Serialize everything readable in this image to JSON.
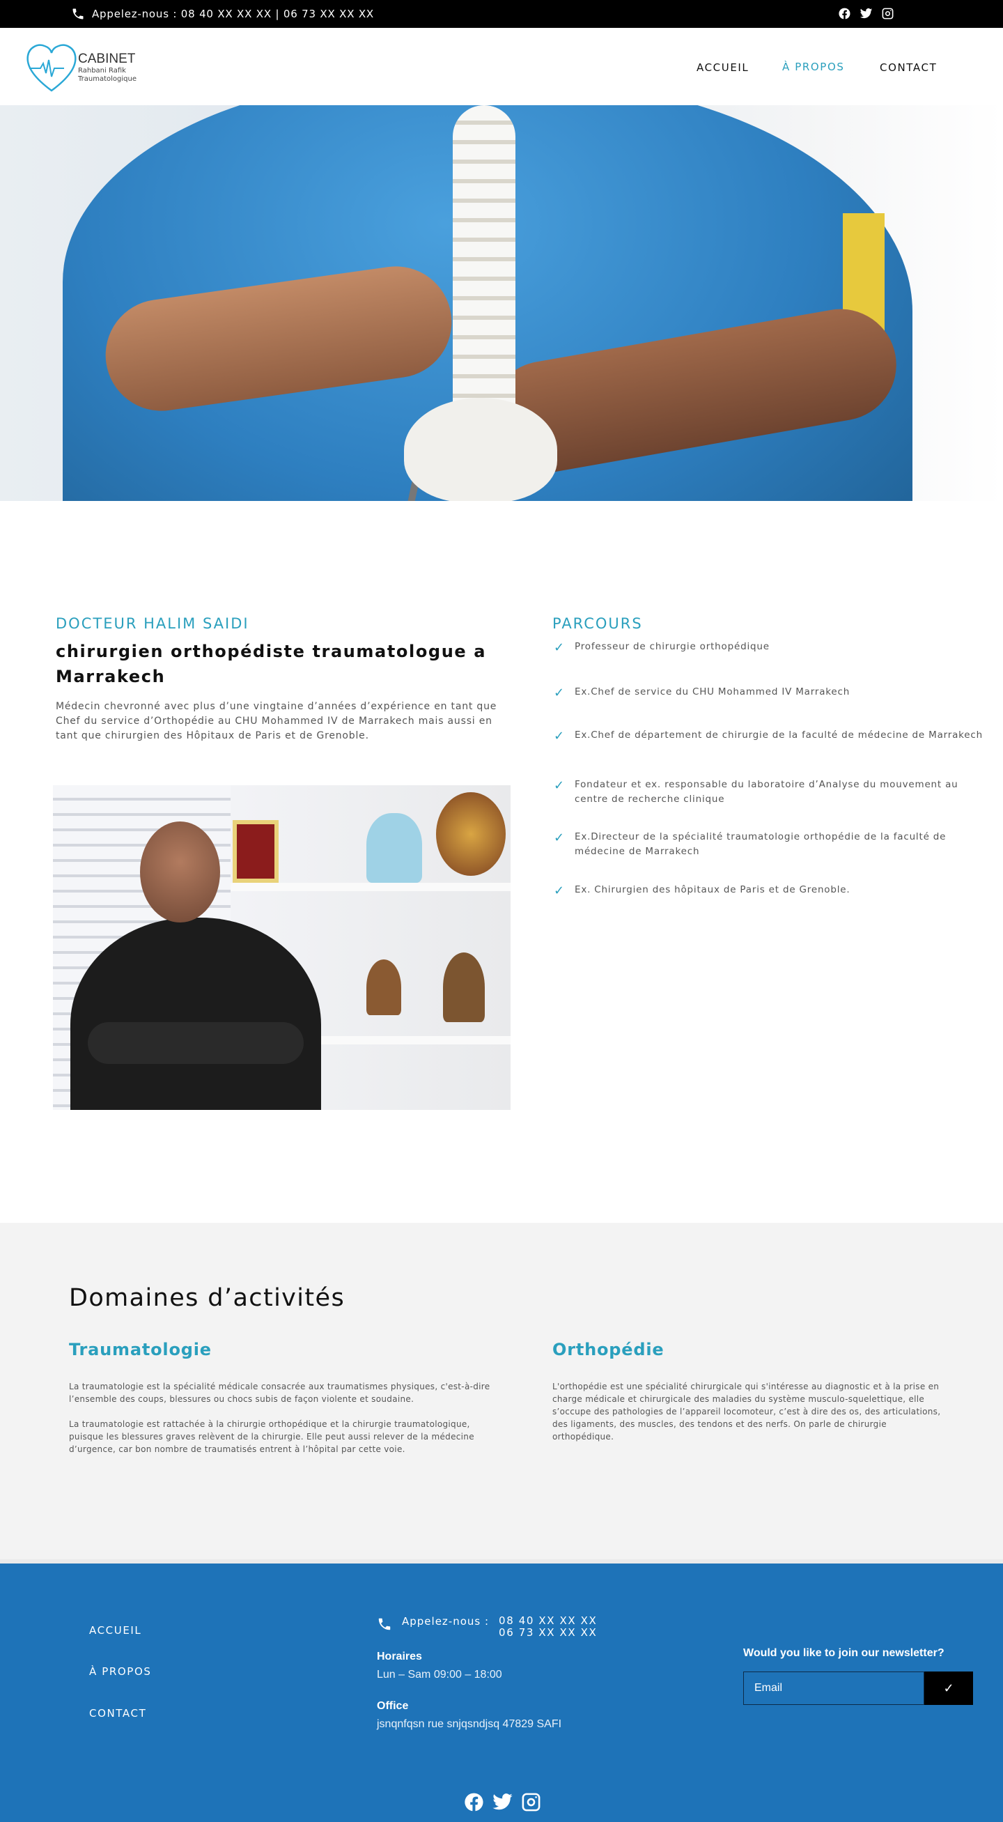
{
  "topbar": {
    "phone_text": "Appelez-nous : 08 40 XX XX XX | 06 73 XX XX XX",
    "socials": [
      "facebook-icon",
      "twitter-icon",
      "instagram-icon"
    ]
  },
  "header": {
    "logo_brand": "CABINET",
    "logo_sub1": "Rahbani Rafik",
    "logo_sub2": "Traumatologique",
    "nav": [
      {
        "label": "ACCUEIL",
        "active": false
      },
      {
        "label": "À PROPOS",
        "active": true
      },
      {
        "label": "CONTACT",
        "active": false
      }
    ]
  },
  "about": {
    "doctor_name": "DOCTEUR HALIM SAIDI",
    "specialty": "chirurgien orthopédiste traumatologue a Marrakech",
    "description": "Médecin chevronné avec plus d’une vingtaine d’années d’expérience en tant que Chef du service d’Orthopédie au CHU Mohammed IV de Marrakech mais aussi en tant que chirurgien des Hôpitaux de Paris et de Grenoble.",
    "parcours_title": "PARCOURS",
    "parcours": [
      "Professeur de chirurgie orthopédique",
      "Ex.Chef de service du CHU Mohammed IV Marrakech",
      "Ex.Chef de département de chirurgie de la faculté de médecine de Marrakech",
      "Fondateur et ex. responsable du laboratoire d’Analyse du mouvement au centre de recherche clinique",
      "Ex.Directeur de la spécialité traumatologie orthopédie de la faculté de médecine de Marrakech",
      "Ex. Chirurgien des hôpitaux de Paris et de Grenoble."
    ]
  },
  "domains": {
    "title": "Domaines d’activités",
    "traumatologie": {
      "title": "Traumatologie",
      "p1": "La traumatologie est la spécialité médicale consacrée aux traumatismes physiques, c'est-à-dire l’ensemble des  coups, blessures ou chocs subis de façon violente et soudaine.",
      "p2": "La traumatologie est rattachée à la chirurgie orthopédique et la chirurgie traumatologique, puisque les blessures graves relèvent de la chirurgie. Elle peut aussi relever de la médecine d’urgence, car bon nombre de traumatisés entrent à l’hôpital par cette voie."
    },
    "orthopedie": {
      "title": "Orthopédie",
      "p1": "L'orthopédie est une spécialité chirurgicale qui s'intéresse au diagnostic et à la prise en charge médicale et chirurgicale des maladies du système musculo-squelettique,  elle s’occupe des pathologies de l’appareil locomoteur, c’est à dire des os, des articulations, des ligaments, des muscles, des tendons et des nerfs. On parle de chirurgie orthopédique."
    }
  },
  "footer": {
    "links": [
      "ACCUEIL",
      "À PROPOS",
      "CONTACT"
    ],
    "call_label": "Appelez-nous :",
    "phone1": "08 40 XX XX XX",
    "phone2": "06 73 XX XX XX",
    "hours_label": "Horaires",
    "hours_value": "Lun – Sam 09:00 – 18:00",
    "office_label": "Office",
    "office_value": "jsnqnfqsn rue snjqsndjsq 47829 SAFI",
    "newsletter_question": "Would you like to join our newsletter?",
    "email_placeholder": "Email",
    "submit_icon": "checkmark-icon",
    "socials": [
      "facebook-icon",
      "twitter-icon",
      "instagram-icon"
    ]
  },
  "colors": {
    "accent": "#2a9fbd",
    "footer_bg": "#1e73b8",
    "topbar_bg": "#000000"
  }
}
